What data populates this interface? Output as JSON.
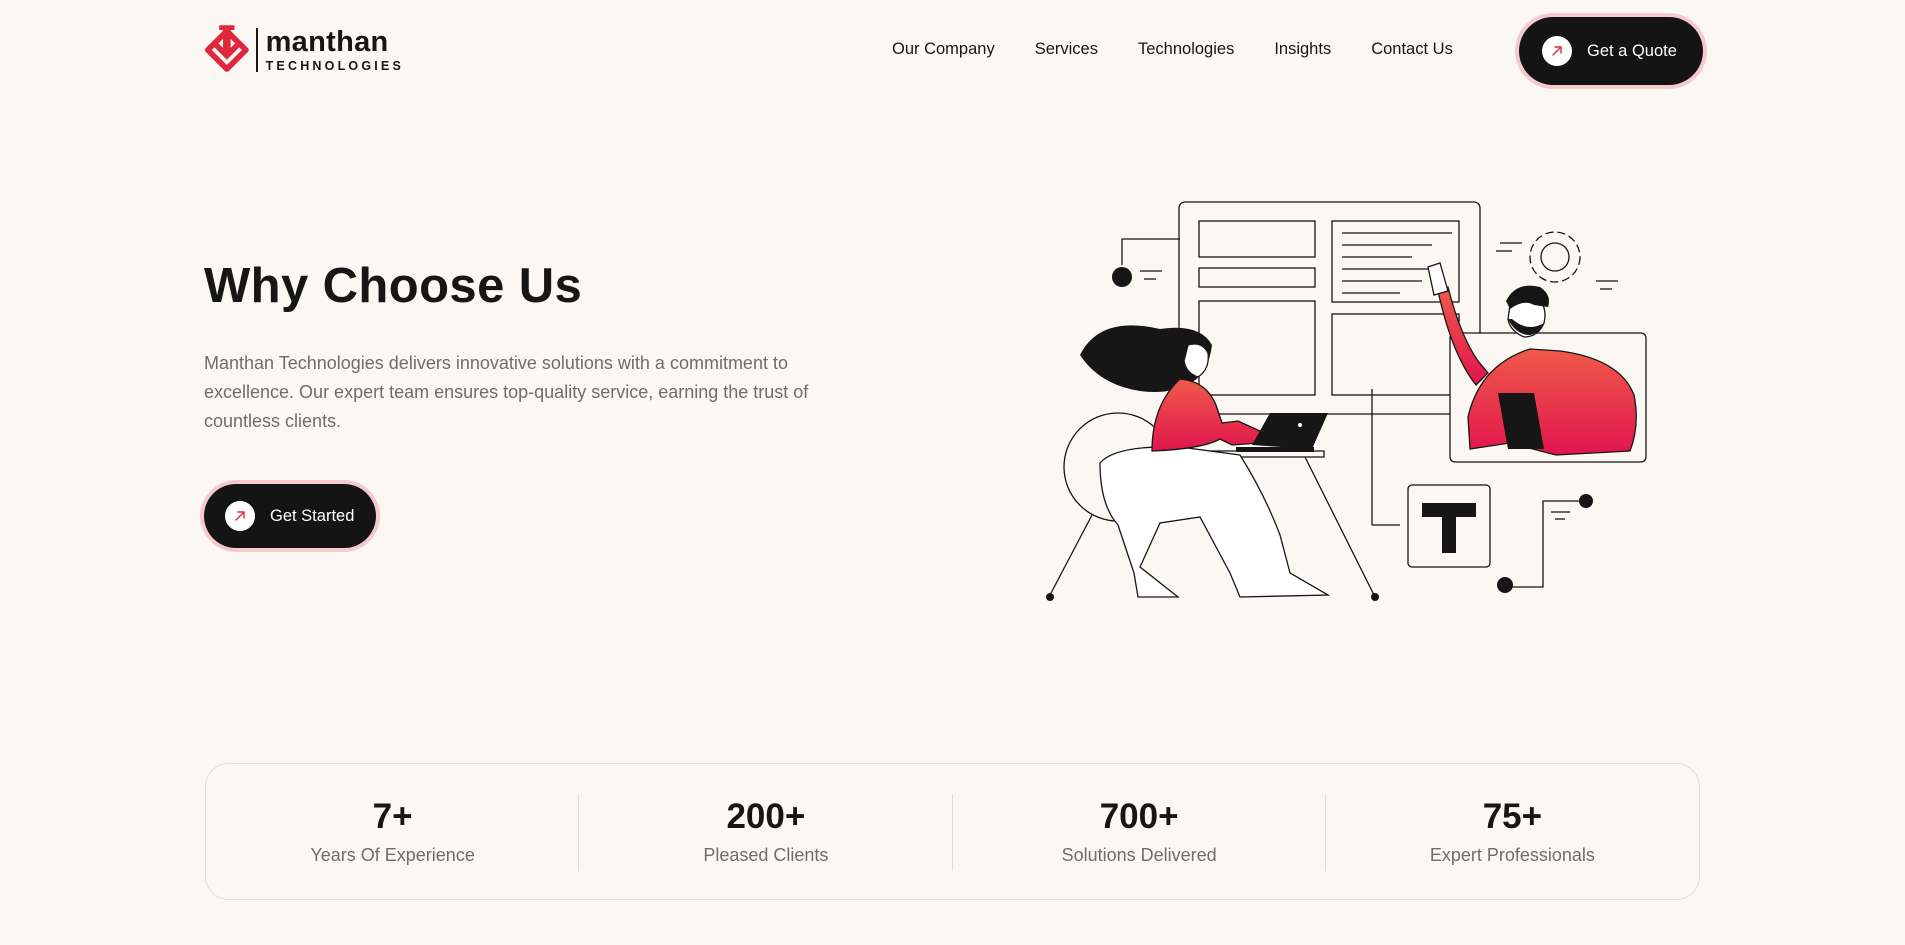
{
  "brand": {
    "name": "manthan",
    "subtitle": "TECHNOLOGIES",
    "accent_color": "#e0283c",
    "dark_color": "#141414",
    "glow_color": "#f6c9cf"
  },
  "nav": {
    "items": [
      {
        "label": "Our Company"
      },
      {
        "label": "Services"
      },
      {
        "label": "Technologies"
      },
      {
        "label": "Insights"
      },
      {
        "label": "Contact Us"
      }
    ],
    "cta_label": "Get a Quote",
    "cta_icon": "arrow-up-right-icon"
  },
  "hero": {
    "title": "Why Choose Us",
    "description": "Manthan Technologies delivers innovative solutions with a commitment to excellence. Our expert team ensures top-quality service, earning the trust of countless clients.",
    "cta_label": "Get Started",
    "cta_icon": "arrow-up-right-icon"
  },
  "stats": [
    {
      "value": "7+",
      "label": "Years Of Experience"
    },
    {
      "value": "200+",
      "label": "Pleased Clients"
    },
    {
      "value": "700+",
      "label": "Solutions Delivered"
    },
    {
      "value": "75+",
      "label": "Expert Professionals"
    }
  ]
}
